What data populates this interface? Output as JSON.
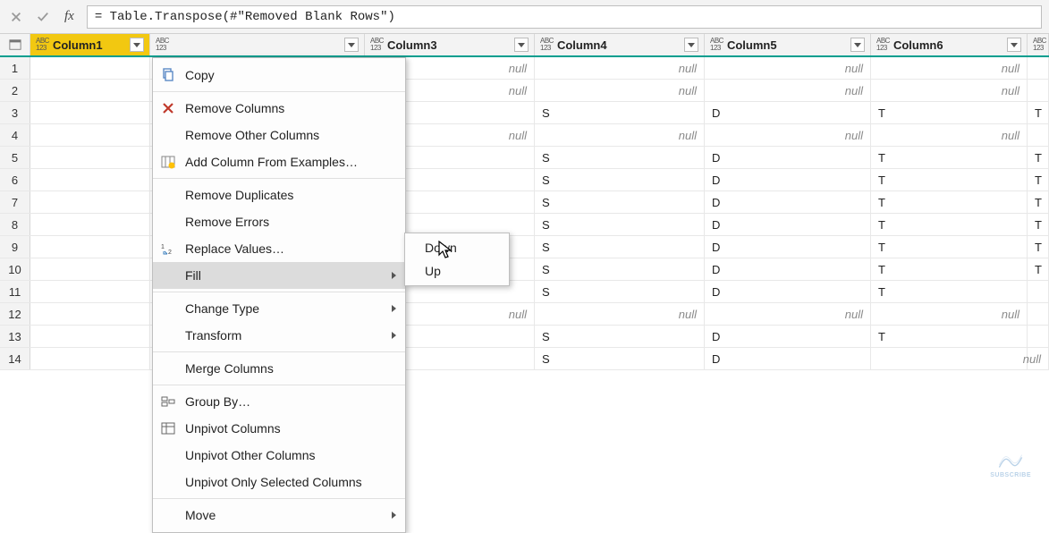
{
  "formula_bar": {
    "fx_label": "fx",
    "formula": "= Table.Transpose(#\"Removed Blank Rows\")"
  },
  "type_icon": {
    "top": "ABC",
    "bottom": "123"
  },
  "columns": [
    {
      "name": "Column1",
      "selected": true
    },
    {
      "name": "",
      "selected": false
    },
    {
      "name": "Column3",
      "selected": false
    },
    {
      "name": "Column4",
      "selected": false
    },
    {
      "name": "Column5",
      "selected": false
    },
    {
      "name": "Column6",
      "selected": false
    },
    {
      "name": "",
      "selected": false
    }
  ],
  "rows": [
    {
      "n": "1",
      "cells": [
        "",
        "",
        "null",
        "null",
        "null",
        "null",
        ""
      ]
    },
    {
      "n": "2",
      "cells": [
        "",
        "",
        "null",
        "null",
        "null",
        "null",
        ""
      ]
    },
    {
      "n": "3",
      "cells": [
        "",
        "",
        "",
        "S",
        "D",
        "T",
        "T"
      ]
    },
    {
      "n": "4",
      "cells": [
        "",
        "",
        "null",
        "null",
        "null",
        "null",
        ""
      ]
    },
    {
      "n": "5",
      "cells": [
        "",
        "",
        "",
        "S",
        "D",
        "T",
        "T"
      ]
    },
    {
      "n": "6",
      "cells": [
        "",
        "",
        "",
        "S",
        "D",
        "T",
        "T"
      ]
    },
    {
      "n": "7",
      "cells": [
        "",
        "",
        "",
        "S",
        "D",
        "T",
        "T"
      ]
    },
    {
      "n": "8",
      "cells": [
        "",
        "",
        "",
        "S",
        "D",
        "T",
        "T"
      ]
    },
    {
      "n": "9",
      "cells": [
        "",
        "",
        "",
        "S",
        "D",
        "T",
        "T"
      ]
    },
    {
      "n": "10",
      "cells": [
        "",
        "",
        "",
        "S",
        "D",
        "T",
        "T"
      ]
    },
    {
      "n": "11",
      "cells": [
        "",
        "",
        "",
        "S",
        "D",
        "T",
        ""
      ]
    },
    {
      "n": "12",
      "cells": [
        "",
        "",
        "null",
        "null",
        "null",
        "null",
        ""
      ]
    },
    {
      "n": "13",
      "cells": [
        "",
        "",
        "",
        "S",
        "D",
        "T",
        ""
      ]
    },
    {
      "n": "14",
      "cells": [
        "",
        "",
        "",
        "S",
        "D",
        "",
        "null"
      ]
    }
  ],
  "null_text": "null",
  "context_menu": {
    "items": [
      {
        "label": "Copy",
        "icon": "copy"
      },
      {
        "sep": true
      },
      {
        "label": "Remove Columns",
        "icon": "remove"
      },
      {
        "label": "Remove Other Columns"
      },
      {
        "label": "Add Column From Examples…",
        "icon": "add-column"
      },
      {
        "sep": true
      },
      {
        "label": "Remove Duplicates"
      },
      {
        "label": "Remove Errors"
      },
      {
        "label": "Replace Values…",
        "icon": "replace"
      },
      {
        "label": "Fill",
        "submenu": true,
        "hover": true
      },
      {
        "sep": true
      },
      {
        "label": "Change Type",
        "submenu": true
      },
      {
        "label": "Transform",
        "submenu": true
      },
      {
        "sep": true
      },
      {
        "label": "Merge Columns"
      },
      {
        "sep": true
      },
      {
        "label": "Group By…",
        "icon": "group-by"
      },
      {
        "label": "Unpivot Columns",
        "icon": "unpivot"
      },
      {
        "label": "Unpivot Other Columns"
      },
      {
        "label": "Unpivot Only Selected Columns"
      },
      {
        "sep": true
      },
      {
        "label": "Move",
        "submenu": true
      }
    ],
    "fill_submenu": [
      "Down",
      "Up"
    ]
  },
  "watermark": {
    "text": "SUBSCRIBE"
  }
}
